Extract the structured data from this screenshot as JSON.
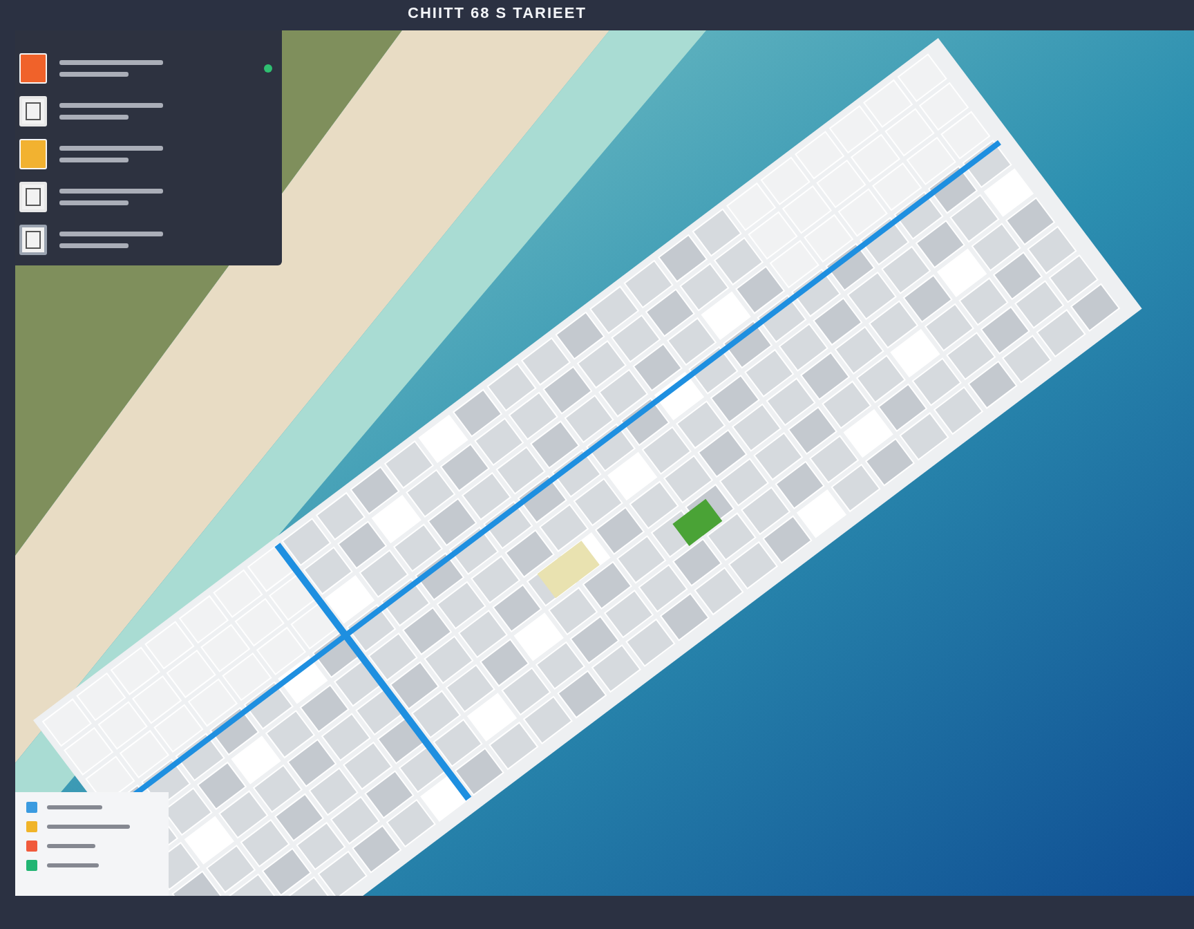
{
  "title_bar": {
    "title": "CHIITT 68 S TARIEET"
  },
  "layers_panel": {
    "layers": [
      {
        "kind": "filled",
        "color": "#f0622a",
        "active": true
      },
      {
        "kind": "outline",
        "color": "#e8e8e8",
        "active": false
      },
      {
        "kind": "filled",
        "color": "#f2b230",
        "active": false
      },
      {
        "kind": "outline",
        "color": "#e8e8e8",
        "active": false
      },
      {
        "kind": "outline",
        "color": "#9aa3b0",
        "active": false
      }
    ]
  },
  "legend": {
    "items": [
      {
        "color": "#3b9be0"
      },
      {
        "color": "#f0b429"
      },
      {
        "color": "#f05a3c"
      },
      {
        "color": "#22b573"
      }
    ]
  }
}
